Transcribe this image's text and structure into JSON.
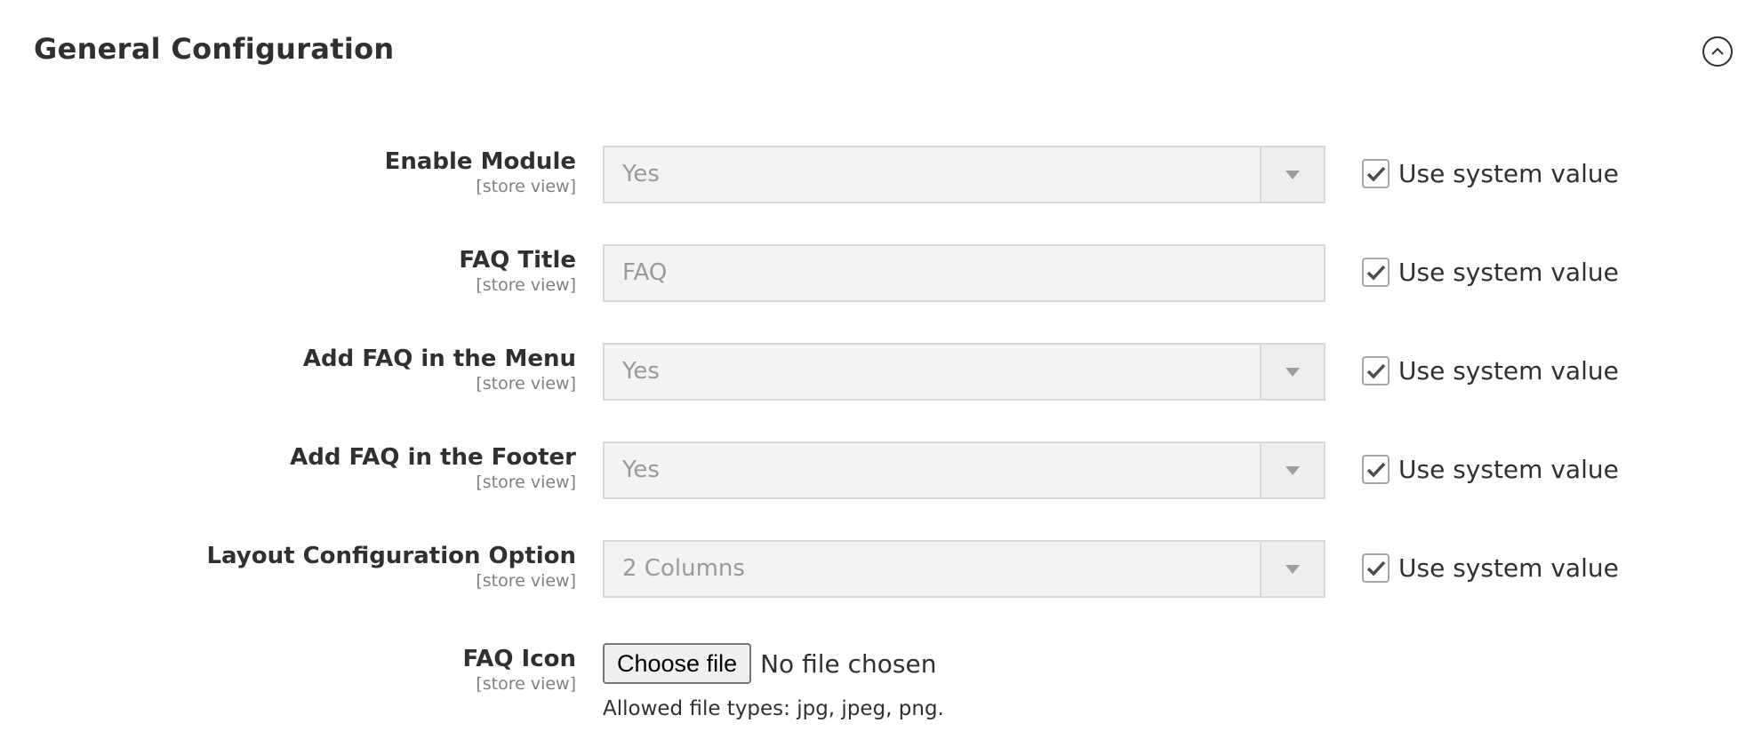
{
  "section": {
    "title": "General Configuration",
    "collapse_icon": "chevron-up-circle-icon"
  },
  "fields": [
    {
      "label": "Enable Module",
      "scope": "[store view]",
      "type": "select",
      "value": "Yes",
      "use_system_value": true,
      "use_system_label": "Use system value"
    },
    {
      "label": "FAQ Title",
      "scope": "[store view]",
      "type": "text",
      "value": "FAQ",
      "use_system_value": true,
      "use_system_label": "Use system value"
    },
    {
      "label": "Add FAQ in the Menu",
      "scope": "[store view]",
      "type": "select",
      "value": "Yes",
      "use_system_value": true,
      "use_system_label": "Use system value"
    },
    {
      "label": "Add FAQ in the Footer",
      "scope": "[store view]",
      "type": "select",
      "value": "Yes",
      "use_system_value": true,
      "use_system_label": "Use system value"
    },
    {
      "label": "Layout Configuration Option",
      "scope": "[store view]",
      "type": "select",
      "value": "2 Columns",
      "use_system_value": true,
      "use_system_label": "Use system value"
    }
  ],
  "file_field": {
    "label": "FAQ Icon",
    "scope": "[store view]",
    "button": "Choose file",
    "status": "No file chosen",
    "hint": "Allowed file types: jpg, jpeg, png."
  }
}
